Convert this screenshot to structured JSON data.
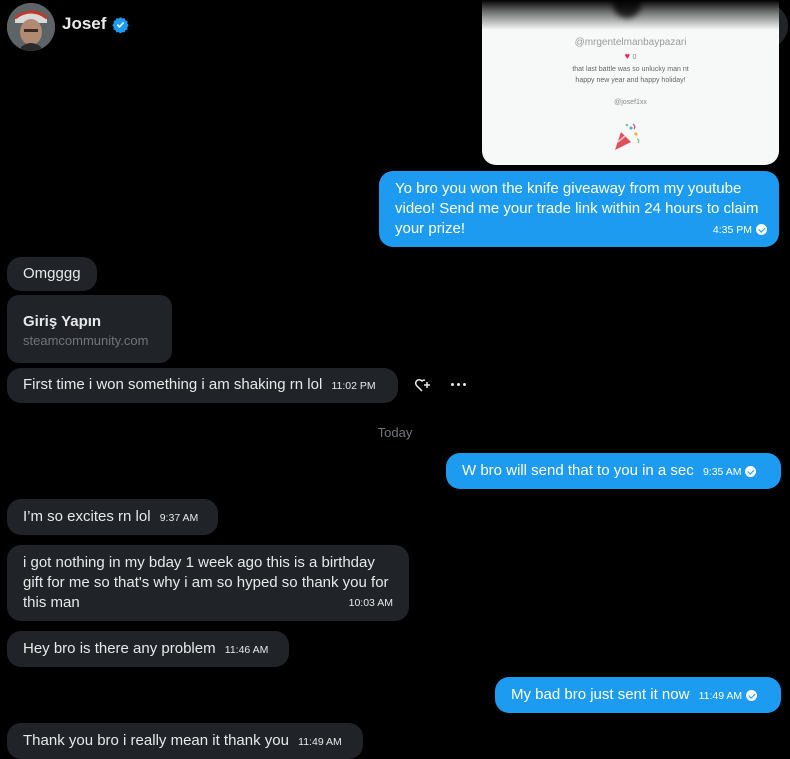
{
  "header": {
    "name": "Josef",
    "verified_icon": "verified-badge-icon",
    "more_icon": "more-dots-icon"
  },
  "preview_card": {
    "handle": "@mrgentelmanbaypazari",
    "likes": "0",
    "text_line1": "that last battle was so unlucky man nt",
    "text_line2": "happy new year and happy holiday!",
    "username": "@josef1xx",
    "icon": "party-popper-icon"
  },
  "messages": [
    {
      "dir": "out",
      "text": "Yo bro you won the knife giveaway from my youtube video! Send me your trade link within 24 hours to claim your prize!",
      "time": "4:35 PM"
    },
    {
      "dir": "in",
      "text": "Omgggg",
      "time": ""
    },
    {
      "dir": "in",
      "text": "First time i won something i am shaking rn lol",
      "time": "11:02 PM"
    },
    {
      "dir": "out",
      "text": "W bro will send that to you in a sec",
      "time": "9:35 AM"
    },
    {
      "dir": "in",
      "text": "I’m so excites rn lol",
      "time": "9:37 AM"
    },
    {
      "dir": "in",
      "text": "i got nothing in my bday 1 week ago this is a birthday gift for me so that's why i am so hyped so thank you for this man",
      "time": "10:03 AM"
    },
    {
      "dir": "in",
      "text": "Hey bro is there any problem",
      "time": "11:46 AM"
    },
    {
      "dir": "out",
      "text": "My bad bro just sent it now",
      "time": "11:49 AM"
    },
    {
      "dir": "in",
      "text": "Thank you bro i really mean it thank you",
      "time": "11:49 AM"
    }
  ],
  "link_card": {
    "title": "Giriş Yapın",
    "domain": "steamcommunity.com"
  },
  "message_actions": {
    "react_icon": "add-reaction-icon",
    "more_icon": "message-more-icon"
  },
  "day_divider": "Today",
  "colors": {
    "outgoing": "#1d9bf0",
    "incoming": "#202327",
    "background": "#000000",
    "muted": "#71767b"
  }
}
